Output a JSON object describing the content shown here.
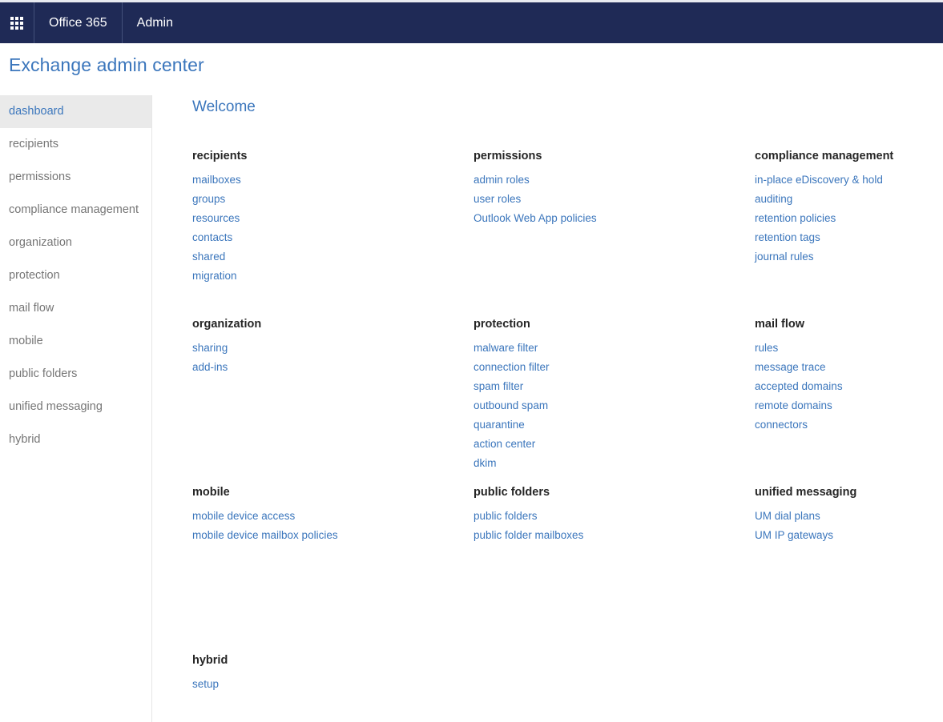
{
  "suite_bar": {
    "waffle_icon": "app-launcher-icon",
    "brand": "Office 365",
    "app": "Admin",
    "background_color": "#1f2a56"
  },
  "page_title": "Exchange admin center",
  "theme": {
    "link_color": "#3b76bc",
    "nav_text_color": "#767676",
    "selected_background": "#eaeaea",
    "heading_color": "#262626"
  },
  "sidebar": {
    "items": [
      {
        "label": "dashboard",
        "selected": true
      },
      {
        "label": "recipients",
        "selected": false
      },
      {
        "label": "permissions",
        "selected": false
      },
      {
        "label": "compliance management",
        "selected": false
      },
      {
        "label": "organization",
        "selected": false
      },
      {
        "label": "protection",
        "selected": false
      },
      {
        "label": "mail flow",
        "selected": false
      },
      {
        "label": "mobile",
        "selected": false
      },
      {
        "label": "public folders",
        "selected": false
      },
      {
        "label": "unified messaging",
        "selected": false
      },
      {
        "label": "hybrid",
        "selected": false
      }
    ]
  },
  "main": {
    "welcome": "Welcome",
    "groups": [
      {
        "title": "recipients",
        "links": [
          "mailboxes",
          "groups",
          "resources",
          "contacts",
          "shared",
          "migration"
        ]
      },
      {
        "title": "permissions",
        "links": [
          "admin roles",
          "user roles",
          "Outlook Web App policies"
        ]
      },
      {
        "title": "compliance management",
        "links": [
          "in-place eDiscovery & hold",
          "auditing",
          "retention policies",
          "retention tags",
          "journal rules"
        ]
      },
      {
        "title": "organization",
        "links": [
          "sharing",
          "add-ins"
        ]
      },
      {
        "title": "protection",
        "links": [
          "malware filter",
          "connection filter",
          "spam filter",
          "outbound spam",
          "quarantine",
          "action center",
          "dkim"
        ]
      },
      {
        "title": "mail flow",
        "links": [
          "rules",
          "message trace",
          "accepted domains",
          "remote domains",
          "connectors"
        ]
      },
      {
        "title": "mobile",
        "links": [
          "mobile device access",
          "mobile device mailbox policies"
        ]
      },
      {
        "title": "public folders",
        "links": [
          "public folders",
          "public folder mailboxes"
        ]
      },
      {
        "title": "unified messaging",
        "links": [
          "UM dial plans",
          "UM IP gateways"
        ]
      },
      {
        "title": "hybrid",
        "links": [
          "setup"
        ]
      }
    ]
  }
}
